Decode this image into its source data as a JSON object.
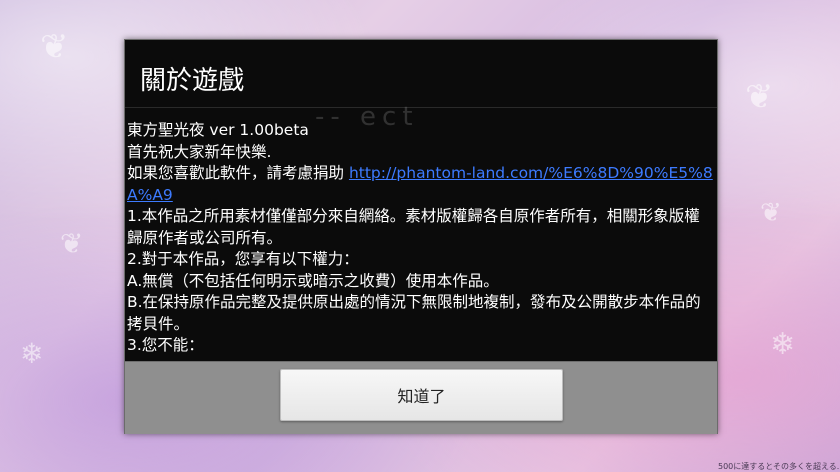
{
  "background": {
    "footer_text": "500に達するとその多くを超える..."
  },
  "dialog": {
    "title": "關於遊戲",
    "ghost_text": "-- ect",
    "lines": [
      "東方聖光夜 ver 1.00beta",
      " 首先祝大家新年快樂.",
      " 如果您喜歡此軟件，請考慮捐助 ",
      " 1.本作品之所用素材僅僅部分來自網絡。素材版權歸各自原作者所有，相關形象版權歸原作者或公司所有。",
      " 2.對于本作品，您享有以下權力：",
      " A.無償（不包括任何明示或暗示之收費）使用本作品。",
      " B.在保持原作品完整及提供原出處的情況下無限制地複制，發布及公開散步本作品的拷貝件。",
      " 3.您不能："
    ],
    "donate_link": "http://phantom-land.com/%E6%8D%90%E5%8A%A9",
    "ok_button_label": "知道了"
  },
  "colors": {
    "dialog_bg": "#0b0b0b",
    "link": "#3d7bff",
    "button_bar": "#8f8f8f"
  }
}
